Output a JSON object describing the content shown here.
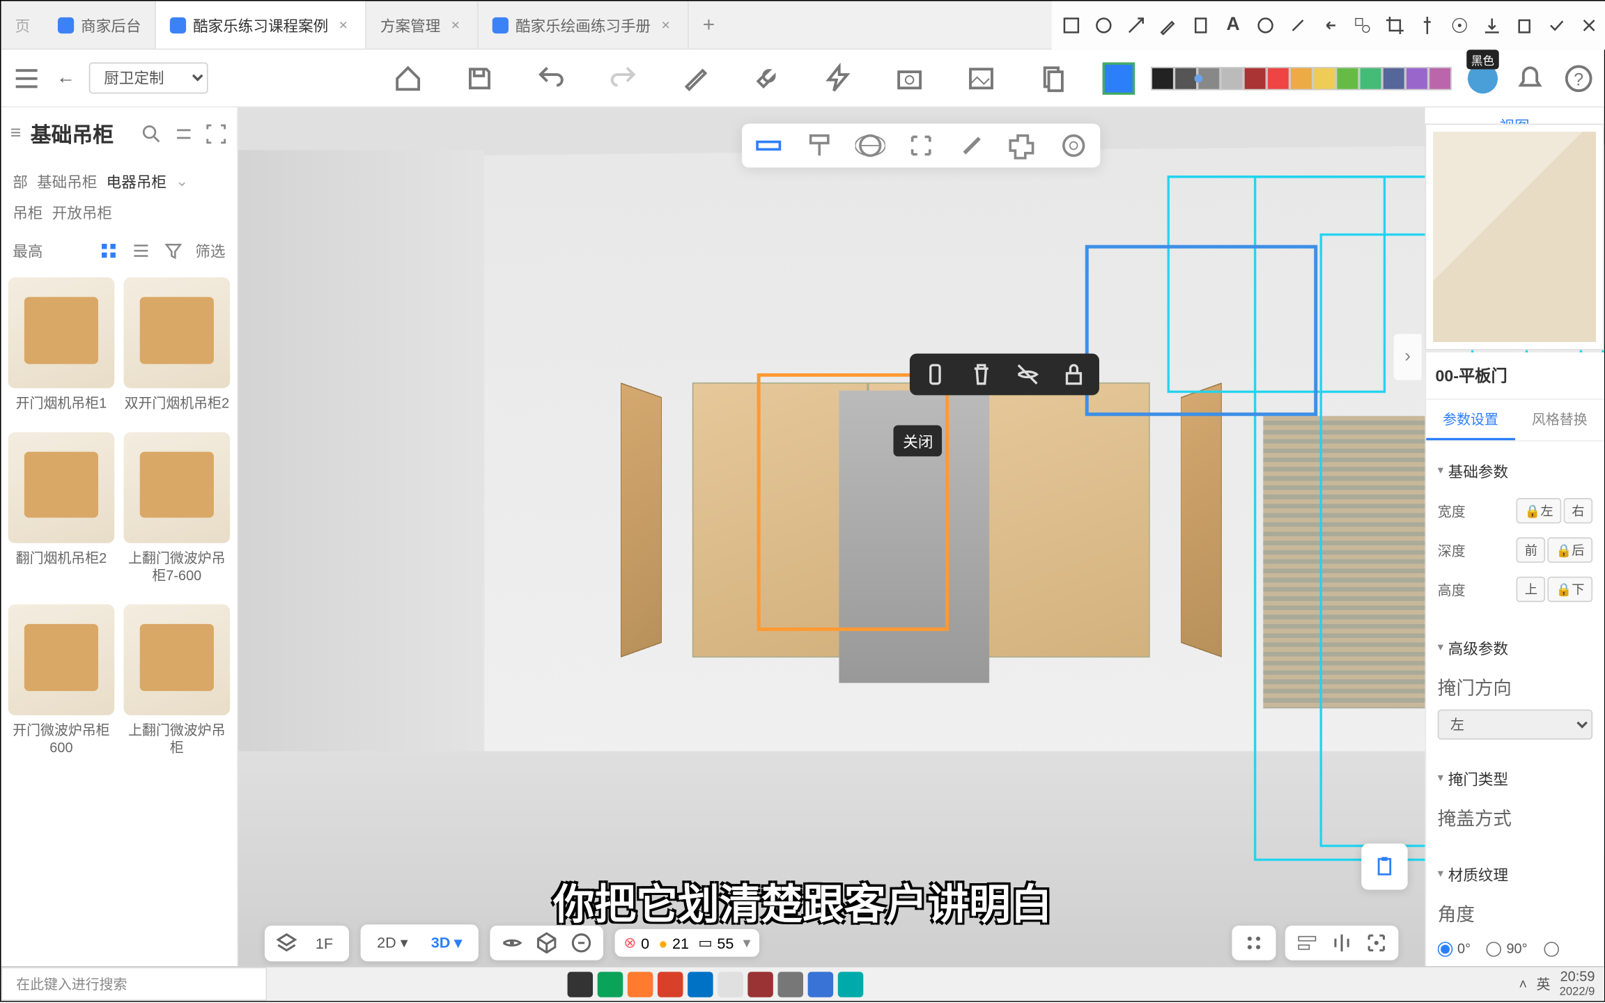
{
  "tabs": [
    {
      "label": "商家后台",
      "active": false,
      "icon": true
    },
    {
      "label": "酷家乐练习课程案例",
      "active": true,
      "icon": true
    },
    {
      "label": "方案管理",
      "active": false,
      "icon": false
    },
    {
      "label": "酷家乐绘画练习手册",
      "active": false,
      "icon": true
    }
  ],
  "toolbar": {
    "mode_select": "厨卫定制",
    "user_tooltip": "黑色"
  },
  "color_palette": [
    "#222",
    "#555",
    "#888",
    "#bbb",
    "#a33",
    "#e44",
    "#ea4",
    "#ec5",
    "#6b4",
    "#4b7",
    "#569",
    "#96c",
    "#b6a"
  ],
  "selected_color": "#2d7ff9",
  "sidebar": {
    "title": "基础吊柜",
    "crumb": [
      "部",
      "基础吊柜",
      "电器吊柜"
    ],
    "crumb2": [
      "吊柜",
      "开放吊柜"
    ],
    "crumb_active": 2,
    "sort": "最高",
    "filter": "筛选",
    "items": [
      {
        "label": "开门烟机吊柜1"
      },
      {
        "label": "双开门烟机吊柜2"
      },
      {
        "label": "翻门烟机吊柜2"
      },
      {
        "label": "上翻门微波炉吊柜7-600"
      },
      {
        "label": "开门微波炉吊柜600"
      },
      {
        "label": "上翻门微波炉吊柜"
      }
    ]
  },
  "context_tip": "关闭",
  "minimap": {
    "tab": "视图"
  },
  "props": {
    "title": "00-平板门",
    "tabs": [
      "参数设置",
      "风格替换"
    ],
    "active_tab": 0,
    "sections": {
      "basic": {
        "h": "基础参数",
        "rows": [
          {
            "label": "宽度",
            "btns": [
              "🔒左",
              "右"
            ]
          },
          {
            "label": "深度",
            "btns": [
              "前",
              "🔒后"
            ]
          },
          {
            "label": "高度",
            "btns": [
              "上",
              "🔒下"
            ]
          }
        ]
      },
      "adv": {
        "h": "高级参数",
        "door_dir_label": "掩门方向",
        "door_dir_val": "左"
      },
      "type": {
        "h": "掩门类型",
        "cover_label": "掩盖方式"
      },
      "mat": {
        "h": "材质纹理",
        "angle_label": "角度",
        "angles": [
          "0°",
          "90°"
        ]
      }
    }
  },
  "bottom": {
    "floor": "1F",
    "d2": "2D",
    "d3": "3D",
    "err": "0",
    "warn": "21",
    "box": "55"
  },
  "subtitle": "你把它划清楚跟客户讲明白",
  "taskbar": {
    "search": "在此键入进行搜索",
    "ime": "英",
    "time": "20:59",
    "date": "2022/9"
  }
}
